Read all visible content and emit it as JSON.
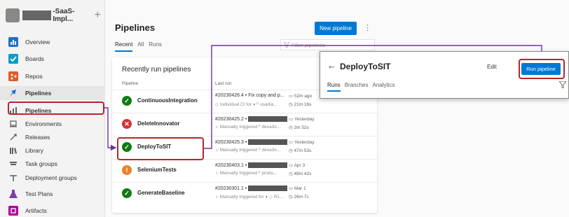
{
  "sidebar": {
    "project_name": "-SaaS-Impl...",
    "add_glyph": "+",
    "items": [
      {
        "label": "Overview",
        "icon": "overview-icon",
        "color": "#1e6fcc"
      },
      {
        "label": "Boards",
        "icon": "boards-icon",
        "color": "#009ccc"
      },
      {
        "label": "Repos",
        "icon": "repos-icon",
        "color": "#e05b28"
      },
      {
        "label": "Pipelines",
        "icon": "pipelines-icon",
        "color": "#1e6fcc"
      },
      {
        "label": "Pipelines",
        "icon": "pipelines-sub-icon",
        "color": "#605e5c"
      },
      {
        "label": "Environments",
        "icon": "environments-icon",
        "color": "#605e5c"
      },
      {
        "label": "Releases",
        "icon": "releases-icon",
        "color": "#605e5c"
      },
      {
        "label": "Library",
        "icon": "library-icon",
        "color": "#605e5c"
      },
      {
        "label": "Task groups",
        "icon": "task-groups-icon",
        "color": "#605e5c"
      },
      {
        "label": "Deployment groups",
        "icon": "deployment-groups-icon",
        "color": "#605e5c"
      },
      {
        "label": "Test Plans",
        "icon": "test-plans-icon",
        "color": "#7a3ea8"
      },
      {
        "label": "Artifacts",
        "icon": "artifacts-icon",
        "color": "#b4009e"
      }
    ]
  },
  "main": {
    "title": "Pipelines",
    "new_button": "New pipeline",
    "more_glyph": "⋮",
    "tabs": [
      "Recent",
      "All",
      "Runs"
    ],
    "filter_placeholder": "Filter pipelines",
    "card_title": "Recently run pipelines",
    "col_pipeline": "Pipeline",
    "col_last_run": "Last run",
    "rows": [
      {
        "name": "ContinuousIntegration",
        "status": "success",
        "run_title": "#20230426.4 • Fix copy and p...",
        "run_sub": "Individual CI for",
        "run_sub2": "usarlia...",
        "when": "52m ago",
        "duration": "21m 16s"
      },
      {
        "name": "DeleteInnovator",
        "status": "failed",
        "run_title": "#20230425.2 •",
        "run_sub": "Manually triggered",
        "run_sub2": "deva3o...",
        "when": "Yesterday",
        "duration": "2m 52s"
      },
      {
        "name": "DeployToSIT",
        "status": "success",
        "run_title": "#20230425.3 •",
        "run_sub": "Manually triggered",
        "run_sub2": "deva3o...",
        "when": "Yesterday",
        "duration": "47m 53s"
      },
      {
        "name": "SeleniumTests",
        "status": "warning",
        "run_title": "#20230403.1 •",
        "run_sub": "Manually triggered",
        "run_sub2": "produ...",
        "when": "Apr 3",
        "duration": "49m 42s"
      },
      {
        "name": "GenerateBaseline",
        "status": "success",
        "run_title": "#20230301.1 •",
        "run_sub": "Manually triggered for",
        "run_sub2": "R1...",
        "when": "Mar 1",
        "duration": "26m 7c"
      }
    ]
  },
  "overlay": {
    "back_glyph": "←",
    "title": "DeployToSIT",
    "edit": "Edit",
    "run_button": "Run pipeline",
    "tabs": [
      "Runs",
      "Branches",
      "Analytics"
    ]
  },
  "colors": {
    "accent": "#0078d4",
    "highlight": "#b3262e",
    "success": "#107c10",
    "failed": "#d13438",
    "warning": "#e9822c",
    "connector": "#7030a0"
  }
}
